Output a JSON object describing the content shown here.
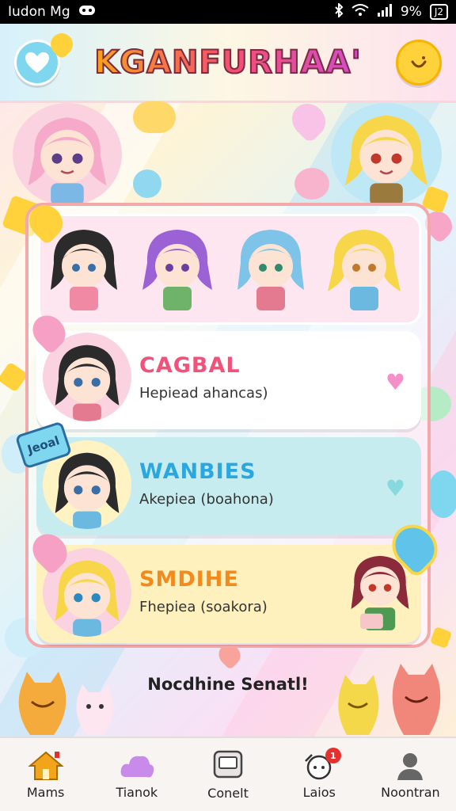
{
  "status_bar": {
    "left_text": "Iudon Mg",
    "battery_percent": "9%",
    "battery_label": "J2"
  },
  "header": {
    "title": "KGANFURHAA'"
  },
  "cards": [
    {
      "title": "CAGBAL",
      "subtitle": "Hepiead ahancas)",
      "title_color": "#f2527a",
      "bg": "#ffffff",
      "heart_color": "#f58fc8"
    },
    {
      "title": "WANBIES",
      "subtitle": "Akepiea (boahona)",
      "title_color": "#2aa7e0",
      "bg": "#c6ecef",
      "heart_color": "#86d9dd"
    },
    {
      "title": "SMDIHE",
      "subtitle": "Fhepiea (soakora)",
      "title_color": "#f28a1d",
      "bg": "#fff1bd",
      "heart_color": "#f27aa4"
    }
  ],
  "ticket_label": "Jeoal",
  "tagline": "Nocdhine Senatl!",
  "bottom_nav": [
    {
      "label": "Mams",
      "icon": "home-icon",
      "color": "#f2a51a",
      "active": true
    },
    {
      "label": "Tianok",
      "icon": "cloud-icon",
      "color": "#c88be9",
      "active": false
    },
    {
      "label": "Conelt",
      "icon": "message-icon",
      "color": "#555555",
      "active": false
    },
    {
      "label": "Laios",
      "icon": "character-icon",
      "color": "#555555",
      "active": false,
      "badge": "1"
    },
    {
      "label": "Noontran",
      "icon": "user-icon",
      "color": "#555555",
      "active": false
    }
  ]
}
